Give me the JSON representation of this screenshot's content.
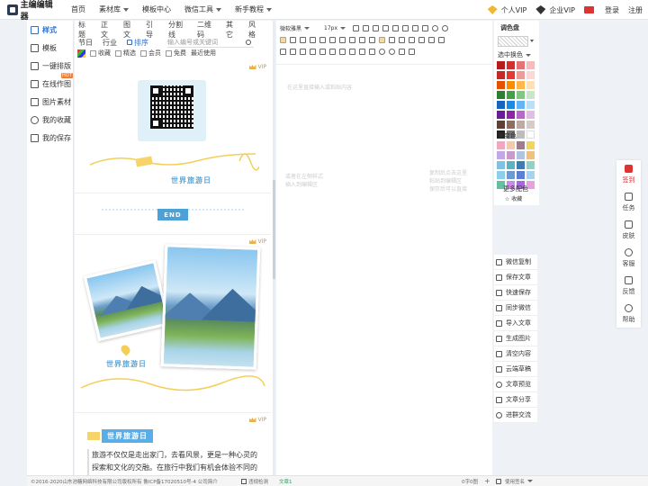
{
  "app": {
    "logo_text": "主编编辑器"
  },
  "nav": [
    {
      "label": "首页",
      "dropdown": false
    },
    {
      "label": "素材库",
      "dropdown": true
    },
    {
      "label": "模板中心",
      "dropdown": false
    },
    {
      "label": "微信工具",
      "dropdown": true
    },
    {
      "label": "新手教程",
      "dropdown": true
    }
  ],
  "topright": {
    "personal_vip": "个人VIP",
    "company_vip": "企业VIP",
    "login": "登录",
    "register": "注册"
  },
  "leftmenu": [
    {
      "label": "样式",
      "icon": "style-icon",
      "active": true
    },
    {
      "label": "模板",
      "icon": "template-icon",
      "active": false
    },
    {
      "label": "一键排版",
      "icon": "layout-icon",
      "active": false
    },
    {
      "label": "在线作图",
      "icon": "image-edit-icon",
      "active": false,
      "badge": "HOT"
    },
    {
      "label": "图片素材",
      "icon": "picture-icon",
      "active": false
    },
    {
      "label": "我的收藏",
      "icon": "heart-icon",
      "active": false
    },
    {
      "label": "我的保存",
      "icon": "save-icon",
      "active": false
    }
  ],
  "categories_row1": [
    "标题",
    "正文",
    "图文",
    "引导",
    "分割线",
    "二维码",
    "其它",
    "风格"
  ],
  "categories_row2": [
    "节日",
    "行业"
  ],
  "sort_label": "排序",
  "search": {
    "placeholder": "输入编号或关键词"
  },
  "filters": [
    "收藏",
    "精选",
    "会员",
    "免费",
    "最近使用"
  ],
  "templates": {
    "vip_label": "VIP",
    "banner_title_1": "世界旅游日",
    "end_label": "END",
    "banner_title_2": "世界旅游日",
    "section_title": "世界旅游日",
    "article": "旅游不仅仅是走出家门，去看风景，更是一种心灵的探索和文化的交融。在旅行中我们有机会体验不同的风土人情，感受异域的文化魅力。"
  },
  "toolbar": {
    "font": "微软雅黑",
    "size": "17px"
  },
  "editor": {
    "ghost_1": "在这里直接输入或粘贴内容",
    "ghost_2": "或者在左侧样式\n插入到编辑区",
    "ghost_3": "复制后点击这里\n粘贴到编辑区\n保存后可以直接"
  },
  "colorpanel": {
    "title": "调色盘",
    "selected_label": "选中换色",
    "gradient_label": "渐变色",
    "more_label": "更多配色",
    "fav_label": "收藏",
    "colors": [
      "#b71c1c",
      "#d32f2f",
      "#e57373",
      "#f8bbbb",
      "#c62828",
      "#e53935",
      "#ef9a9a",
      "#fdd6d6",
      "#e65100",
      "#fb8c00",
      "#ffb74d",
      "#ffe0b2",
      "#2e7d32",
      "#43a047",
      "#81c784",
      "#c8e6c9",
      "#1565c0",
      "#1e88e5",
      "#64b5f6",
      "#bbdefb",
      "#6a1b9a",
      "#8e24aa",
      "#ba68c8",
      "#e1bee7",
      "#5d4037",
      "#8d6e63",
      "#bcaaa4",
      "#d7ccc8",
      "#212121",
      "#757575",
      "#bdbdbd",
      "#ffffff"
    ],
    "gradients": [
      "#f6a5c0",
      "#f8c9a9",
      "#9e7c8a",
      "#f3d55b",
      "#c6a7e6",
      "#cc99cc",
      "#b0c4de",
      "#f0c080",
      "#7dc4e4",
      "#5ab4c4",
      "#3c7db8",
      "#8fd3c6",
      "#8bd0e8",
      "#6a9bd6",
      "#5c7fd3",
      "#a6d3f0",
      "#64c0a0",
      "#cc88ee",
      "#aa66dd",
      "#e8a0e0"
    ]
  },
  "actions": [
    {
      "label": "微信复制",
      "icon": "wechat-copy-icon"
    },
    {
      "label": "保存文章",
      "icon": "save-article-icon"
    },
    {
      "label": "快速保存",
      "icon": "quick-save-icon"
    },
    {
      "label": "同步微信",
      "icon": "sync-icon"
    },
    {
      "label": "导入文章",
      "icon": "import-icon"
    },
    {
      "label": "生成图片",
      "icon": "image-gen-icon"
    },
    {
      "label": "清空内容",
      "icon": "trash-icon"
    },
    {
      "label": "云端草稿",
      "icon": "cloud-icon"
    },
    {
      "label": "文章预览",
      "icon": "eye-icon"
    },
    {
      "label": "文章分享",
      "icon": "share-icon"
    },
    {
      "label": "进群交流",
      "icon": "group-icon"
    }
  ],
  "rail": [
    {
      "label": "签到",
      "icon": "calendar-icon",
      "red": true
    },
    {
      "label": "任务",
      "icon": "task-icon",
      "red": false
    },
    {
      "label": "皮肤",
      "icon": "shirt-icon",
      "red": false
    },
    {
      "label": "客服",
      "icon": "headset-icon",
      "red": false
    },
    {
      "label": "反馈",
      "icon": "feedback-icon",
      "red": false
    },
    {
      "label": "帮助",
      "icon": "help-icon",
      "red": false
    }
  ],
  "footer": {
    "copyright": "©2016-2020山东池糖网络科技有限公司版权所有 鲁ICP备17020510号-4 公司简介",
    "check_label": "违规检测",
    "article_label": "文章1",
    "count": "0字0图",
    "plus": "+",
    "signature": "使用签名"
  }
}
